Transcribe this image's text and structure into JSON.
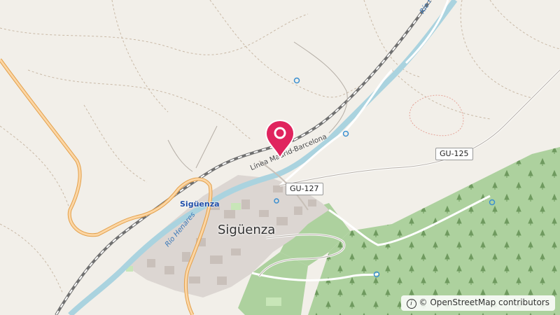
{
  "map": {
    "town": "Sigüenza",
    "station": "Sigüenza",
    "river_labels": [
      "Río Henares",
      "Río Henares"
    ],
    "railway_label": "Línea Madrid-Barcelona",
    "road_shields": [
      "GU-125",
      "GU-127"
    ],
    "marker_icon": "location-pin-icon",
    "colors": {
      "land": "#f2efe9",
      "forest": "#add19e",
      "river": "#aad3df",
      "railway": "#707070",
      "main_road": "#fcd6a4",
      "road_casing": "#e3a04b",
      "marker": "#e0245e"
    }
  },
  "attribution": {
    "text": "© OpenStreetMap contributors"
  }
}
